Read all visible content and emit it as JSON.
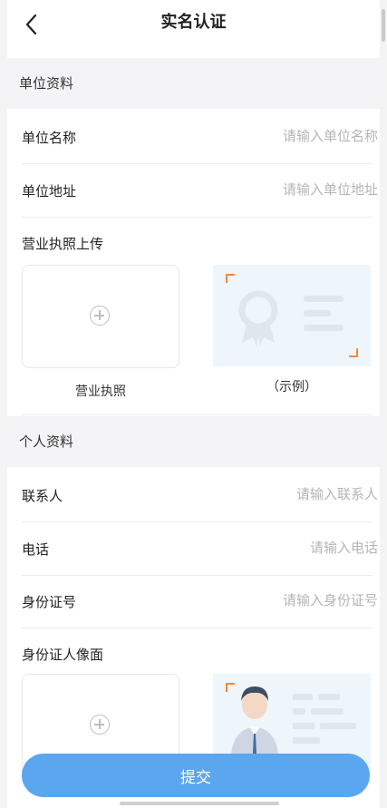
{
  "header": {
    "title": "实名认证"
  },
  "company": {
    "section_title": "单位资料",
    "name_label": "单位名称",
    "name_placeholder": "请输入单位名称",
    "address_label": "单位地址",
    "address_placeholder": "请输入单位地址",
    "license_upload_label": "营业执照上传",
    "license_caption": "营业执照",
    "sample_caption": "（示例）"
  },
  "personal": {
    "section_title": "个人资料",
    "contact_label": "联系人",
    "contact_placeholder": "请输入联系人",
    "phone_label": "电话",
    "phone_placeholder": "请输入电话",
    "id_label": "身份证号",
    "id_placeholder": "请输入身份证号",
    "id_front_label": "身份证人像面"
  },
  "submit_label": "提交",
  "colors": {
    "accent": "#5aa6ef",
    "corner": "#f08a3c",
    "sample_bg": "#eef5fb",
    "section_bg": "#f4f4f6"
  },
  "icons": {
    "back": "chevron-left-icon",
    "add": "plus-circle-icon"
  }
}
